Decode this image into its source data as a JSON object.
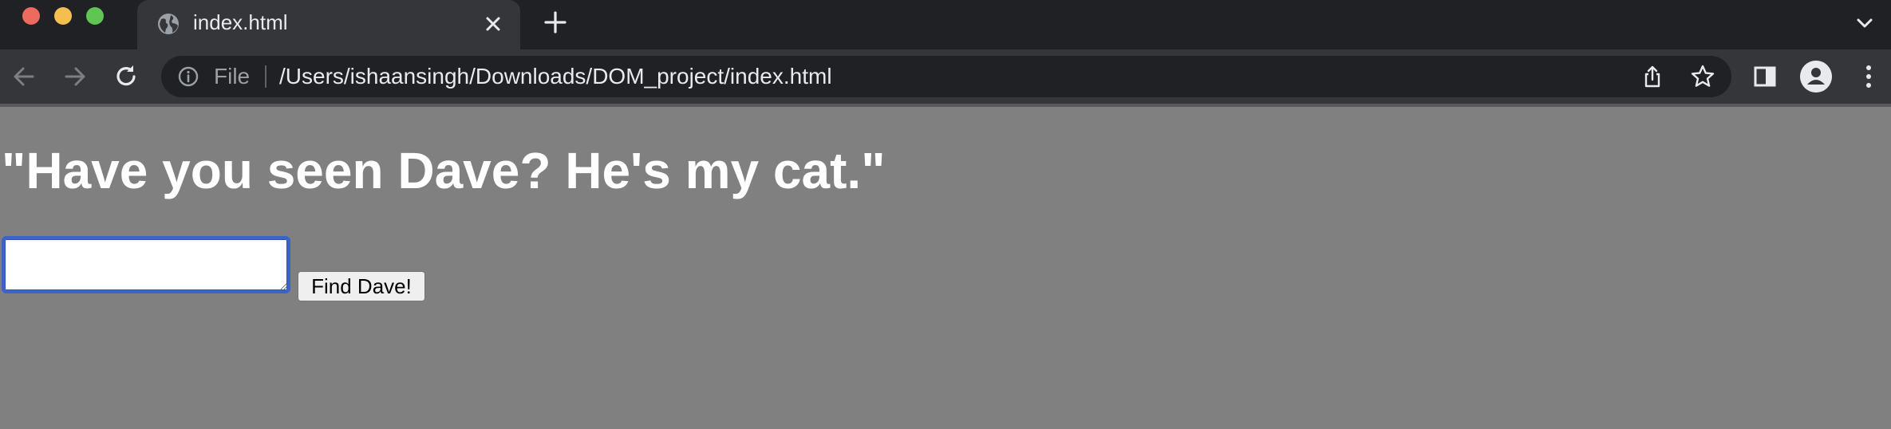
{
  "window": {
    "controls": [
      {
        "name": "close",
        "color": "#ec6a5e"
      },
      {
        "name": "minimize",
        "color": "#f4bf4f"
      },
      {
        "name": "maximize",
        "color": "#61c554"
      }
    ]
  },
  "tabs": [
    {
      "title": "index.html",
      "icon": "globe-icon",
      "active": true
    }
  ],
  "toolbar": {
    "address_scheme": "File",
    "address_url": "/Users/ishaansingh/Downloads/DOM_project/index.html",
    "icons": [
      "back-arrow-icon",
      "forward-arrow-icon",
      "reload-icon",
      "info-icon",
      "share-icon",
      "star-icon",
      "side-panel-icon",
      "profile-icon",
      "kebab-menu-icon"
    ]
  },
  "page": {
    "heading": "\"Have you seen Dave? He's my cat.\"",
    "input_value": "",
    "button_label": "Find Dave!",
    "colors": {
      "background": "#808080",
      "heading": "#ffffff",
      "input_focus_ring": "#3c64c8"
    }
  }
}
